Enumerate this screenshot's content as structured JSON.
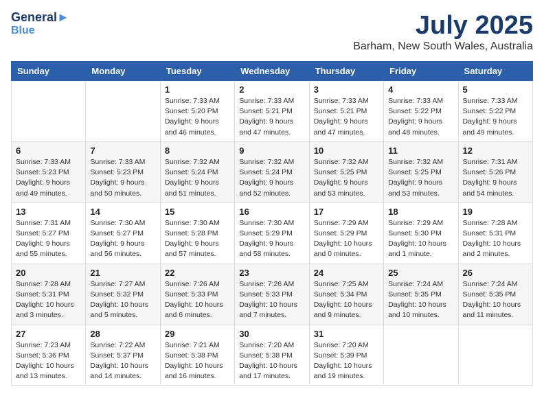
{
  "logo": {
    "line1": "General",
    "line2": "Blue"
  },
  "title": "July 2025",
  "subtitle": "Barham, New South Wales, Australia",
  "weekdays": [
    "Sunday",
    "Monday",
    "Tuesday",
    "Wednesday",
    "Thursday",
    "Friday",
    "Saturday"
  ],
  "weeks": [
    [
      {
        "day": "",
        "info": ""
      },
      {
        "day": "",
        "info": ""
      },
      {
        "day": "1",
        "info": "Sunrise: 7:33 AM\nSunset: 5:20 PM\nDaylight: 9 hours\nand 46 minutes."
      },
      {
        "day": "2",
        "info": "Sunrise: 7:33 AM\nSunset: 5:21 PM\nDaylight: 9 hours\nand 47 minutes."
      },
      {
        "day": "3",
        "info": "Sunrise: 7:33 AM\nSunset: 5:21 PM\nDaylight: 9 hours\nand 47 minutes."
      },
      {
        "day": "4",
        "info": "Sunrise: 7:33 AM\nSunset: 5:22 PM\nDaylight: 9 hours\nand 48 minutes."
      },
      {
        "day": "5",
        "info": "Sunrise: 7:33 AM\nSunset: 5:22 PM\nDaylight: 9 hours\nand 49 minutes."
      }
    ],
    [
      {
        "day": "6",
        "info": "Sunrise: 7:33 AM\nSunset: 5:23 PM\nDaylight: 9 hours\nand 49 minutes."
      },
      {
        "day": "7",
        "info": "Sunrise: 7:33 AM\nSunset: 5:23 PM\nDaylight: 9 hours\nand 50 minutes."
      },
      {
        "day": "8",
        "info": "Sunrise: 7:32 AM\nSunset: 5:24 PM\nDaylight: 9 hours\nand 51 minutes."
      },
      {
        "day": "9",
        "info": "Sunrise: 7:32 AM\nSunset: 5:24 PM\nDaylight: 9 hours\nand 52 minutes."
      },
      {
        "day": "10",
        "info": "Sunrise: 7:32 AM\nSunset: 5:25 PM\nDaylight: 9 hours\nand 53 minutes."
      },
      {
        "day": "11",
        "info": "Sunrise: 7:32 AM\nSunset: 5:25 PM\nDaylight: 9 hours\nand 53 minutes."
      },
      {
        "day": "12",
        "info": "Sunrise: 7:31 AM\nSunset: 5:26 PM\nDaylight: 9 hours\nand 54 minutes."
      }
    ],
    [
      {
        "day": "13",
        "info": "Sunrise: 7:31 AM\nSunset: 5:27 PM\nDaylight: 9 hours\nand 55 minutes."
      },
      {
        "day": "14",
        "info": "Sunrise: 7:30 AM\nSunset: 5:27 PM\nDaylight: 9 hours\nand 56 minutes."
      },
      {
        "day": "15",
        "info": "Sunrise: 7:30 AM\nSunset: 5:28 PM\nDaylight: 9 hours\nand 57 minutes."
      },
      {
        "day": "16",
        "info": "Sunrise: 7:30 AM\nSunset: 5:29 PM\nDaylight: 9 hours\nand 58 minutes."
      },
      {
        "day": "17",
        "info": "Sunrise: 7:29 AM\nSunset: 5:29 PM\nDaylight: 10 hours\nand 0 minutes."
      },
      {
        "day": "18",
        "info": "Sunrise: 7:29 AM\nSunset: 5:30 PM\nDaylight: 10 hours\nand 1 minute."
      },
      {
        "day": "19",
        "info": "Sunrise: 7:28 AM\nSunset: 5:31 PM\nDaylight: 10 hours\nand 2 minutes."
      }
    ],
    [
      {
        "day": "20",
        "info": "Sunrise: 7:28 AM\nSunset: 5:31 PM\nDaylight: 10 hours\nand 3 minutes."
      },
      {
        "day": "21",
        "info": "Sunrise: 7:27 AM\nSunset: 5:32 PM\nDaylight: 10 hours\nand 5 minutes."
      },
      {
        "day": "22",
        "info": "Sunrise: 7:26 AM\nSunset: 5:33 PM\nDaylight: 10 hours\nand 6 minutes."
      },
      {
        "day": "23",
        "info": "Sunrise: 7:26 AM\nSunset: 5:33 PM\nDaylight: 10 hours\nand 7 minutes."
      },
      {
        "day": "24",
        "info": "Sunrise: 7:25 AM\nSunset: 5:34 PM\nDaylight: 10 hours\nand 9 minutes."
      },
      {
        "day": "25",
        "info": "Sunrise: 7:24 AM\nSunset: 5:35 PM\nDaylight: 10 hours\nand 10 minutes."
      },
      {
        "day": "26",
        "info": "Sunrise: 7:24 AM\nSunset: 5:35 PM\nDaylight: 10 hours\nand 11 minutes."
      }
    ],
    [
      {
        "day": "27",
        "info": "Sunrise: 7:23 AM\nSunset: 5:36 PM\nDaylight: 10 hours\nand 13 minutes."
      },
      {
        "day": "28",
        "info": "Sunrise: 7:22 AM\nSunset: 5:37 PM\nDaylight: 10 hours\nand 14 minutes."
      },
      {
        "day": "29",
        "info": "Sunrise: 7:21 AM\nSunset: 5:38 PM\nDaylight: 10 hours\nand 16 minutes."
      },
      {
        "day": "30",
        "info": "Sunrise: 7:20 AM\nSunset: 5:38 PM\nDaylight: 10 hours\nand 17 minutes."
      },
      {
        "day": "31",
        "info": "Sunrise: 7:20 AM\nSunset: 5:39 PM\nDaylight: 10 hours\nand 19 minutes."
      },
      {
        "day": "",
        "info": ""
      },
      {
        "day": "",
        "info": ""
      }
    ]
  ]
}
